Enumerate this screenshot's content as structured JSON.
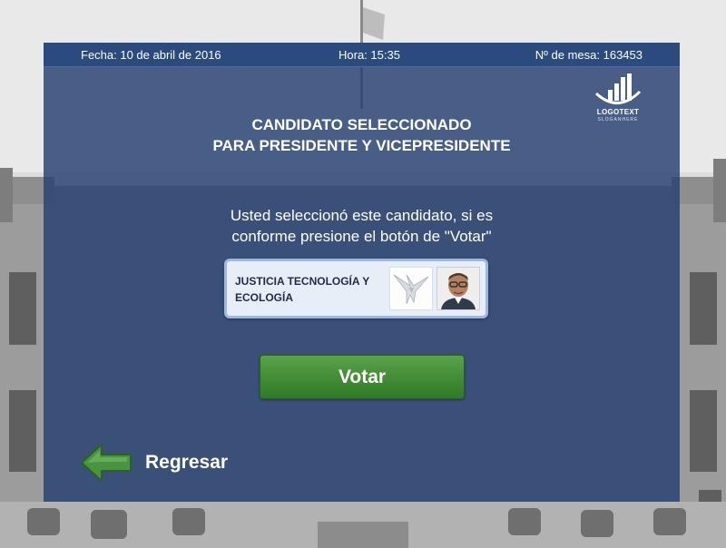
{
  "header": {
    "date_label": "Fecha: 10 de abril de 2016",
    "time_label": "Hora: 15:35",
    "table_label": "Nº de mesa: 163453"
  },
  "logo": {
    "text": "LOGOTEXT",
    "slogan": "SLOGANHERE",
    "icon": "bar-chart-arc-icon"
  },
  "main": {
    "title_line1": "CANDIDATO SELECCIONADO",
    "title_line2": "PARA PRESIDENTE Y VICEPRESIDENTE",
    "instruction_line1": "Usted seleccionó este candidato, si es",
    "instruction_line2": "conforme presione el botón de \"Votar\""
  },
  "candidate": {
    "party_name_line1": "JUSTICIA TECNOLOGÍA Y",
    "party_name_line2": "ECOLOGÍA",
    "party_logo_icon": "dove-icon",
    "photo": "candidate-photo"
  },
  "actions": {
    "vote_label": "Votar",
    "back_label": "Regresar",
    "back_icon": "arrow-left-icon"
  },
  "colors": {
    "panel": "#264070",
    "vote_button": "#3f8a33",
    "back_arrow": "#4a9440"
  }
}
